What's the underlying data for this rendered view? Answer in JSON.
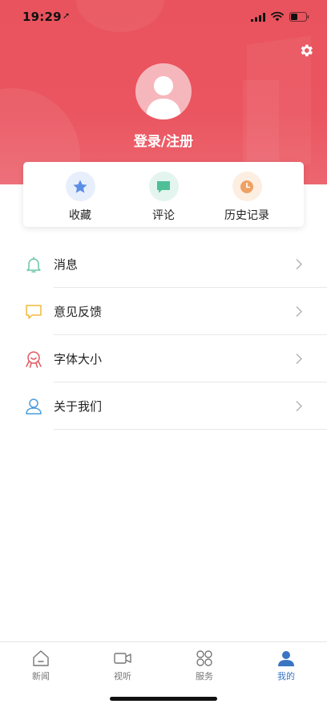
{
  "status_bar": {
    "time": "19:29",
    "location_glyph": "➚"
  },
  "header": {
    "login_label": "登录/注册"
  },
  "quick_actions": [
    {
      "label": "收藏",
      "icon": "star-icon",
      "color": "#5b8ee6",
      "bg": "#e7effc"
    },
    {
      "label": "评论",
      "icon": "comment-icon",
      "color": "#4fbf98",
      "bg": "#e3f5ee"
    },
    {
      "label": "历史记录",
      "icon": "clock-icon",
      "color": "#eea163",
      "bg": "#fdeee2"
    }
  ],
  "menu": [
    {
      "label": "消息",
      "icon": "bell-icon",
      "color": "#6cc7a7"
    },
    {
      "label": "意见反馈",
      "icon": "feedback-icon",
      "color": "#f2b93f"
    },
    {
      "label": "字体大小",
      "icon": "font-size-icon",
      "color": "#e25a62"
    },
    {
      "label": "关于我们",
      "icon": "user-outline-icon",
      "color": "#4a9bdc"
    }
  ],
  "tabs": [
    {
      "label": "新闻",
      "icon": "home-icon",
      "active": false
    },
    {
      "label": "视听",
      "icon": "video-icon",
      "active": false
    },
    {
      "label": "服务",
      "icon": "grid-icon",
      "active": false
    },
    {
      "label": "我的",
      "icon": "person-icon",
      "active": true
    }
  ],
  "colors": {
    "header": "#e9535d",
    "accent": "#3a75c4"
  }
}
